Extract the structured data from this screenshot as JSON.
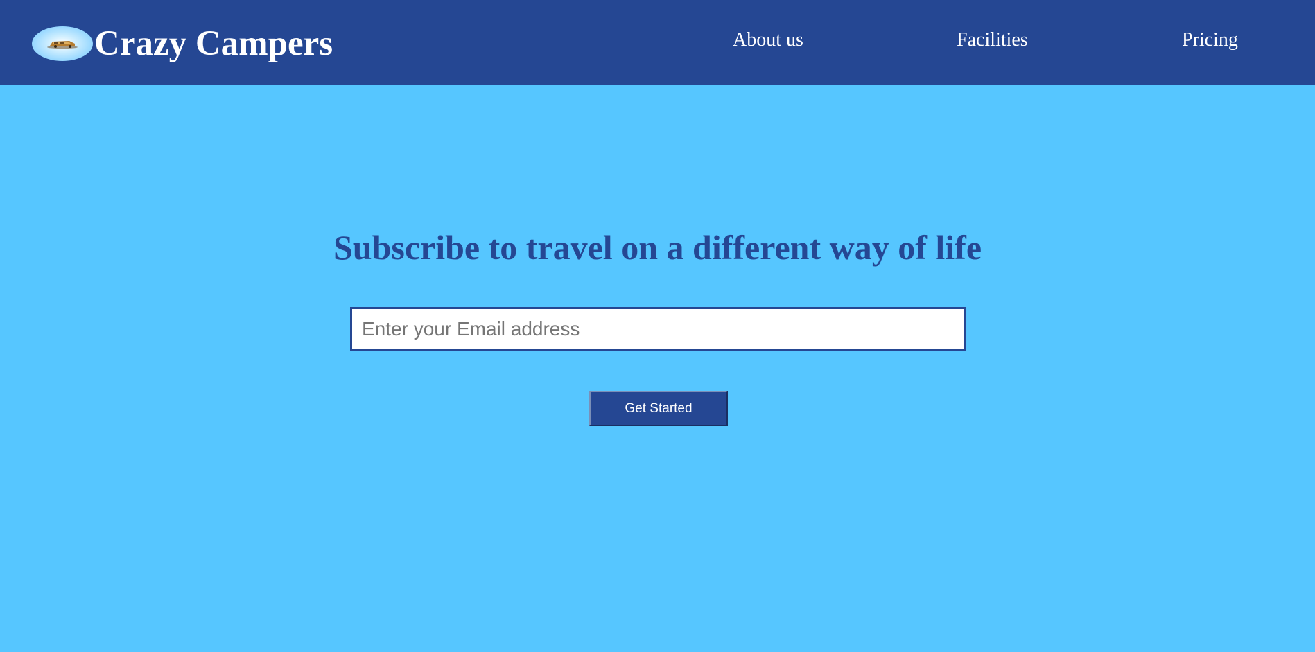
{
  "header": {
    "brand_name": "Crazy Campers",
    "logo_icon": "camper-van-icon",
    "nav": [
      {
        "label": "About us"
      },
      {
        "label": "Facilities"
      },
      {
        "label": "Pricing"
      }
    ]
  },
  "hero": {
    "headline": "Subscribe to travel on a different way of life",
    "email_placeholder": "Enter your Email address",
    "email_value": "",
    "cta_label": "Get Started"
  },
  "colors": {
    "header_bg": "#254793",
    "page_bg": "#56c6ff",
    "accent": "#254793",
    "text_light": "#ffffff"
  }
}
